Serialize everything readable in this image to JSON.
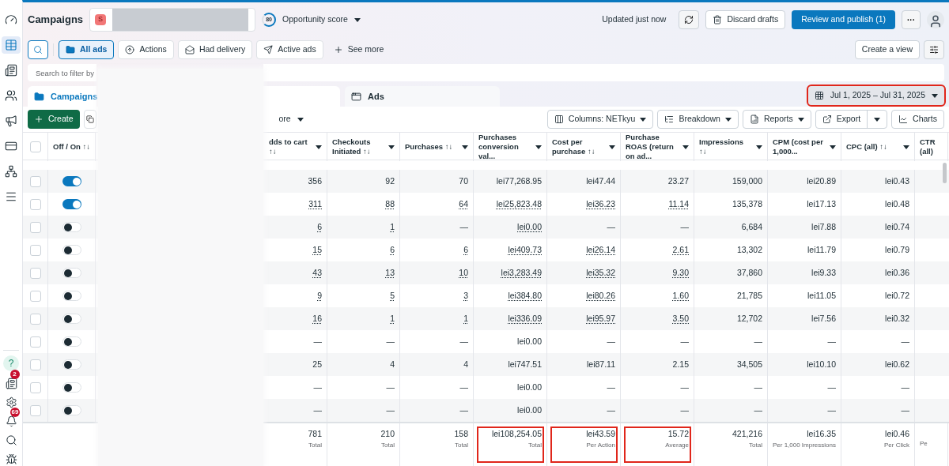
{
  "sidebar": {
    "top_items": [
      {
        "selected": false
      },
      {
        "selected": true
      },
      {
        "selected": false
      },
      {
        "selected": false
      },
      {
        "selected": false
      },
      {
        "selected": false
      },
      {
        "selected": false
      },
      {
        "selected": false
      }
    ],
    "bottom_items": [
      {
        "kind": "help",
        "label": "?"
      },
      {
        "kind": "icon",
        "badge": "2"
      },
      {
        "kind": "icon"
      },
      {
        "kind": "icon",
        "badge": "69"
      },
      {
        "kind": "icon"
      },
      {
        "kind": "icon"
      }
    ]
  },
  "header": {
    "title": "Campaigns",
    "account_initial": "S",
    "score": "80",
    "score_label": "Opportunity score",
    "status": "Updated just now",
    "discard": "Discard drafts",
    "publish": "Review and publish (1)",
    "more": "···"
  },
  "filters": {
    "chips": [
      {
        "label": "All ads",
        "selected": true
      },
      {
        "label": "Actions",
        "selected": false
      },
      {
        "label": "Had delivery",
        "selected": false
      },
      {
        "label": "Active ads",
        "selected": false
      }
    ],
    "see_more": "See more",
    "create_view": "Create a view"
  },
  "search": {
    "placeholder": "Search to filter by"
  },
  "tabs": [
    {
      "label": "Campaigns",
      "selected": true
    },
    {
      "label": "Ads",
      "selected": false
    }
  ],
  "date_range": {
    "label": "Jul 1, 2025 – Jul 31, 2025",
    "highlighted": true
  },
  "toolbar": {
    "create": "Create",
    "more": "ore",
    "columns": "Columns: NETkyu",
    "breakdown": "Breakdown",
    "reports": "Reports",
    "export": "Export",
    "charts": "Charts"
  },
  "table": {
    "all_checked": false,
    "columns": [
      {
        "label": "Off / On ↑↓",
        "menu": false
      },
      {
        "label": "dds to cart ↑↓",
        "menu": true
      },
      {
        "label": "Checkouts Initiated ↑↓",
        "menu": true
      },
      {
        "label": "Purchases ↑↓",
        "menu": true
      },
      {
        "label": "Purchases conversion val...",
        "menu": true
      },
      {
        "label": "Cost per purchase ↑↓",
        "menu": true
      },
      {
        "label": "Purchase ROAS (return on ad...",
        "menu": true
      },
      {
        "label": "Impressions ↑↓",
        "menu": true
      },
      {
        "label": "CPM (cost per 1,000...",
        "menu": true
      },
      {
        "label": "CPC (all) ↑↓",
        "menu": true
      },
      {
        "label": "CTR (all)",
        "menu": false
      }
    ],
    "rows": [
      {
        "checked": false,
        "on": true,
        "linked": false,
        "cells": [
          "356",
          "92",
          "70",
          "lei77,268.95",
          "lei47.44",
          "23.27",
          "159,000",
          "lei20.89",
          "lei0.43"
        ]
      },
      {
        "checked": false,
        "on": true,
        "linked": true,
        "cells": [
          "311",
          "88",
          "64",
          "lei25,823.48",
          "lei36.23",
          "11.14",
          "135,378",
          "lei17.13",
          "lei0.48"
        ]
      },
      {
        "checked": false,
        "on": false,
        "linked": true,
        "cells": [
          "6",
          "1",
          "—",
          "lei0.00",
          "—",
          "—",
          "6,684",
          "lei7.88",
          "lei0.74"
        ]
      },
      {
        "checked": false,
        "on": false,
        "linked": true,
        "cells": [
          "15",
          "6",
          "6",
          "lei409.73",
          "lei26.14",
          "2.61",
          "13,302",
          "lei11.79",
          "lei0.79"
        ]
      },
      {
        "checked": false,
        "on": false,
        "linked": true,
        "cells": [
          "43",
          "13",
          "10",
          "lei3,283.49",
          "lei35.32",
          "9.30",
          "37,860",
          "lei9.33",
          "lei0.36"
        ]
      },
      {
        "checked": false,
        "on": false,
        "linked": true,
        "cells": [
          "9",
          "5",
          "3",
          "lei384.80",
          "lei80.26",
          "1.60",
          "21,785",
          "lei11.05",
          "lei0.72"
        ]
      },
      {
        "checked": false,
        "on": false,
        "linked": true,
        "cells": [
          "16",
          "1",
          "1",
          "lei336.09",
          "lei95.97",
          "3.50",
          "12,702",
          "lei7.56",
          "lei0.32"
        ]
      },
      {
        "checked": false,
        "on": false,
        "linked": false,
        "cells": [
          "—",
          "—",
          "—",
          "lei0.00",
          "—",
          "—",
          "—",
          "—",
          "—"
        ]
      },
      {
        "checked": false,
        "on": false,
        "linked": false,
        "cells": [
          "25",
          "4",
          "4",
          "lei747.51",
          "lei87.11",
          "2.15",
          "34,505",
          "lei10.10",
          "lei0.62"
        ]
      },
      {
        "checked": false,
        "on": false,
        "linked": false,
        "cells": [
          "—",
          "—",
          "—",
          "lei0.00",
          "—",
          "—",
          "—",
          "—",
          "—"
        ]
      },
      {
        "checked": false,
        "on": false,
        "linked": false,
        "cells": [
          "—",
          "—",
          "—",
          "lei0.00",
          "—",
          "—",
          "—",
          "—",
          "—"
        ]
      }
    ],
    "totals": [
      {
        "value": "781",
        "note": "Total",
        "highlighted": false
      },
      {
        "value": "210",
        "note": "Total",
        "highlighted": false
      },
      {
        "value": "158",
        "note": "Total",
        "highlighted": false
      },
      {
        "value": "lei108,254.05",
        "note": "Total",
        "highlighted": true
      },
      {
        "value": "lei43.59",
        "note": "Per Action",
        "highlighted": true
      },
      {
        "value": "15.72",
        "note": "Average",
        "highlighted": true
      },
      {
        "value": "421,216",
        "note": "Total",
        "highlighted": false
      },
      {
        "value": "lei16.35",
        "note": "Per 1,000 Impressions",
        "highlighted": false
      },
      {
        "value": "lei0.46",
        "note": "Per Click",
        "highlighted": false
      },
      {
        "note": "Pe",
        "highlighted": false
      }
    ]
  }
}
